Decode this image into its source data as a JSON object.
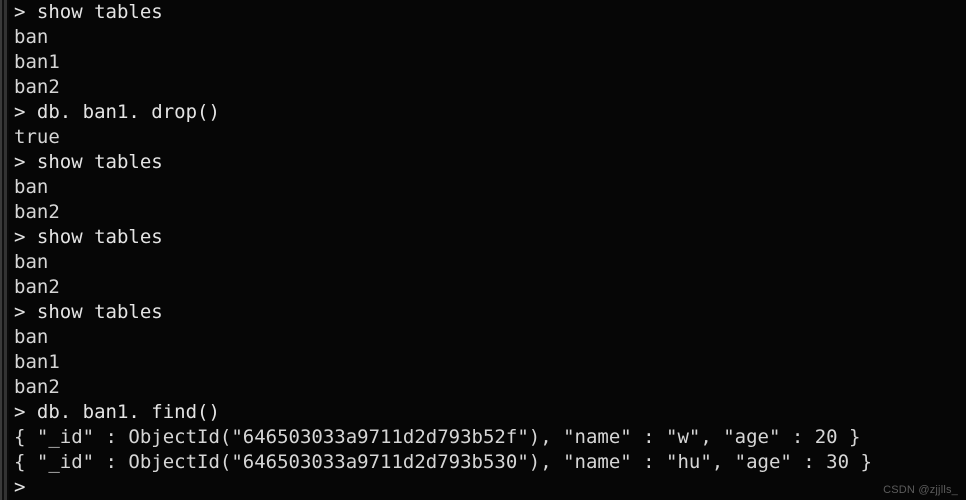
{
  "terminal": {
    "shell": "mongo",
    "prompt_symbol": ">",
    "background_color": "#060606",
    "text_color": "#dcdcdc",
    "lines": [
      {
        "kind": "command",
        "text": "> show tables"
      },
      {
        "kind": "result",
        "text": "ban"
      },
      {
        "kind": "result",
        "text": "ban1"
      },
      {
        "kind": "result",
        "text": "ban2"
      },
      {
        "kind": "command",
        "text": "> db. ban1. drop()"
      },
      {
        "kind": "result",
        "text": "true"
      },
      {
        "kind": "command",
        "text": "> show tables"
      },
      {
        "kind": "result",
        "text": "ban"
      },
      {
        "kind": "result",
        "text": "ban2"
      },
      {
        "kind": "command",
        "text": "> show tables"
      },
      {
        "kind": "result",
        "text": "ban"
      },
      {
        "kind": "result",
        "text": "ban2"
      },
      {
        "kind": "command",
        "text": "> show tables"
      },
      {
        "kind": "result",
        "text": "ban"
      },
      {
        "kind": "result",
        "text": "ban1"
      },
      {
        "kind": "result",
        "text": "ban2"
      },
      {
        "kind": "command",
        "text": "> db. ban1. find()"
      },
      {
        "kind": "document",
        "text": "{ \"_id\" : ObjectId(\"646503033a9711d2d793b52f\"), \"name\" : \"w\", \"age\" : 20 }"
      },
      {
        "kind": "document",
        "text": "{ \"_id\" : ObjectId(\"646503033a9711d2d793b530\"), \"name\" : \"hu\", \"age\" : 30 }"
      },
      {
        "kind": "command",
        "text": ">"
      }
    ]
  },
  "watermark": {
    "text": "CSDN @zjjlls_"
  }
}
